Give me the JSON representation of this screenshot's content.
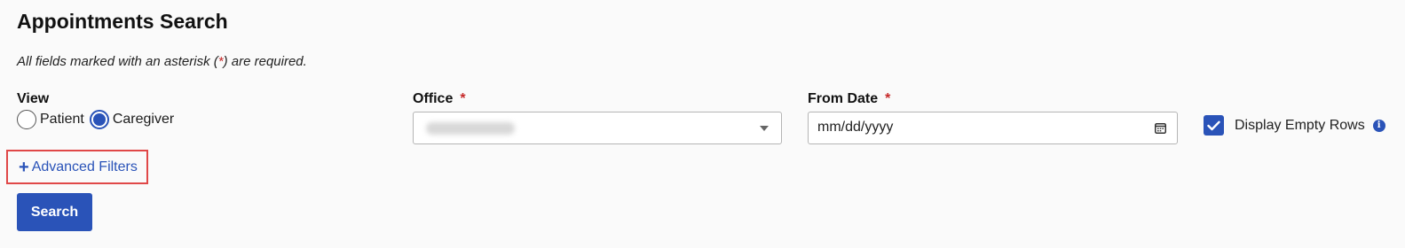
{
  "page": {
    "title": "Appointments Search",
    "required_note_prefix": "All fields marked with an asterisk (",
    "required_note_asterisk": "*",
    "required_note_suffix": ") are required."
  },
  "view": {
    "label": "View",
    "options": [
      {
        "label": "Patient",
        "checked": false
      },
      {
        "label": "Caregiver",
        "checked": true
      }
    ]
  },
  "office": {
    "label": "Office",
    "required_mark": "*"
  },
  "from_date": {
    "label": "From Date",
    "required_mark": "*",
    "placeholder": "mm/dd/yyyy"
  },
  "display_empty_rows": {
    "label": "Display Empty Rows",
    "checked": true,
    "info_glyph": "i"
  },
  "advanced_filters": {
    "icon": "+",
    "label": "Advanced Filters"
  },
  "search_button": {
    "label": "Search"
  },
  "colors": {
    "accent": "#2a53b8",
    "required": "#c62828",
    "highlight_border": "#e04848"
  }
}
